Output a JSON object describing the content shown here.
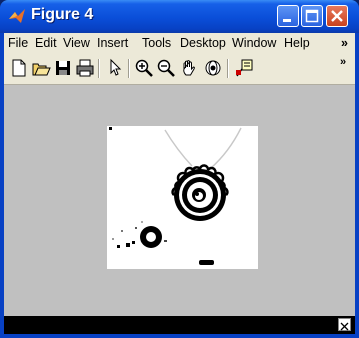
{
  "window": {
    "title": "Figure 4"
  },
  "menu": [
    "File",
    "Edit",
    "View",
    "Insert",
    "Tools",
    "Desktop",
    "Window",
    "Help"
  ],
  "menu_overflow": "»",
  "toolbar": {
    "icons": [
      "new-figure-icon",
      "open-file-icon",
      "save-icon",
      "print-icon",
      "edit-plot-arrow-icon",
      "zoom-in-icon",
      "zoom-out-icon",
      "pan-hand-icon",
      "rotate-3d-icon",
      "data-cursor-icon"
    ],
    "overflow": "»"
  },
  "colors": {
    "titlebar": "#0a4ed8",
    "figure_bg": "#c0c0c0",
    "menubar_bg": "#ece9d8",
    "statusbar": "#000000"
  }
}
